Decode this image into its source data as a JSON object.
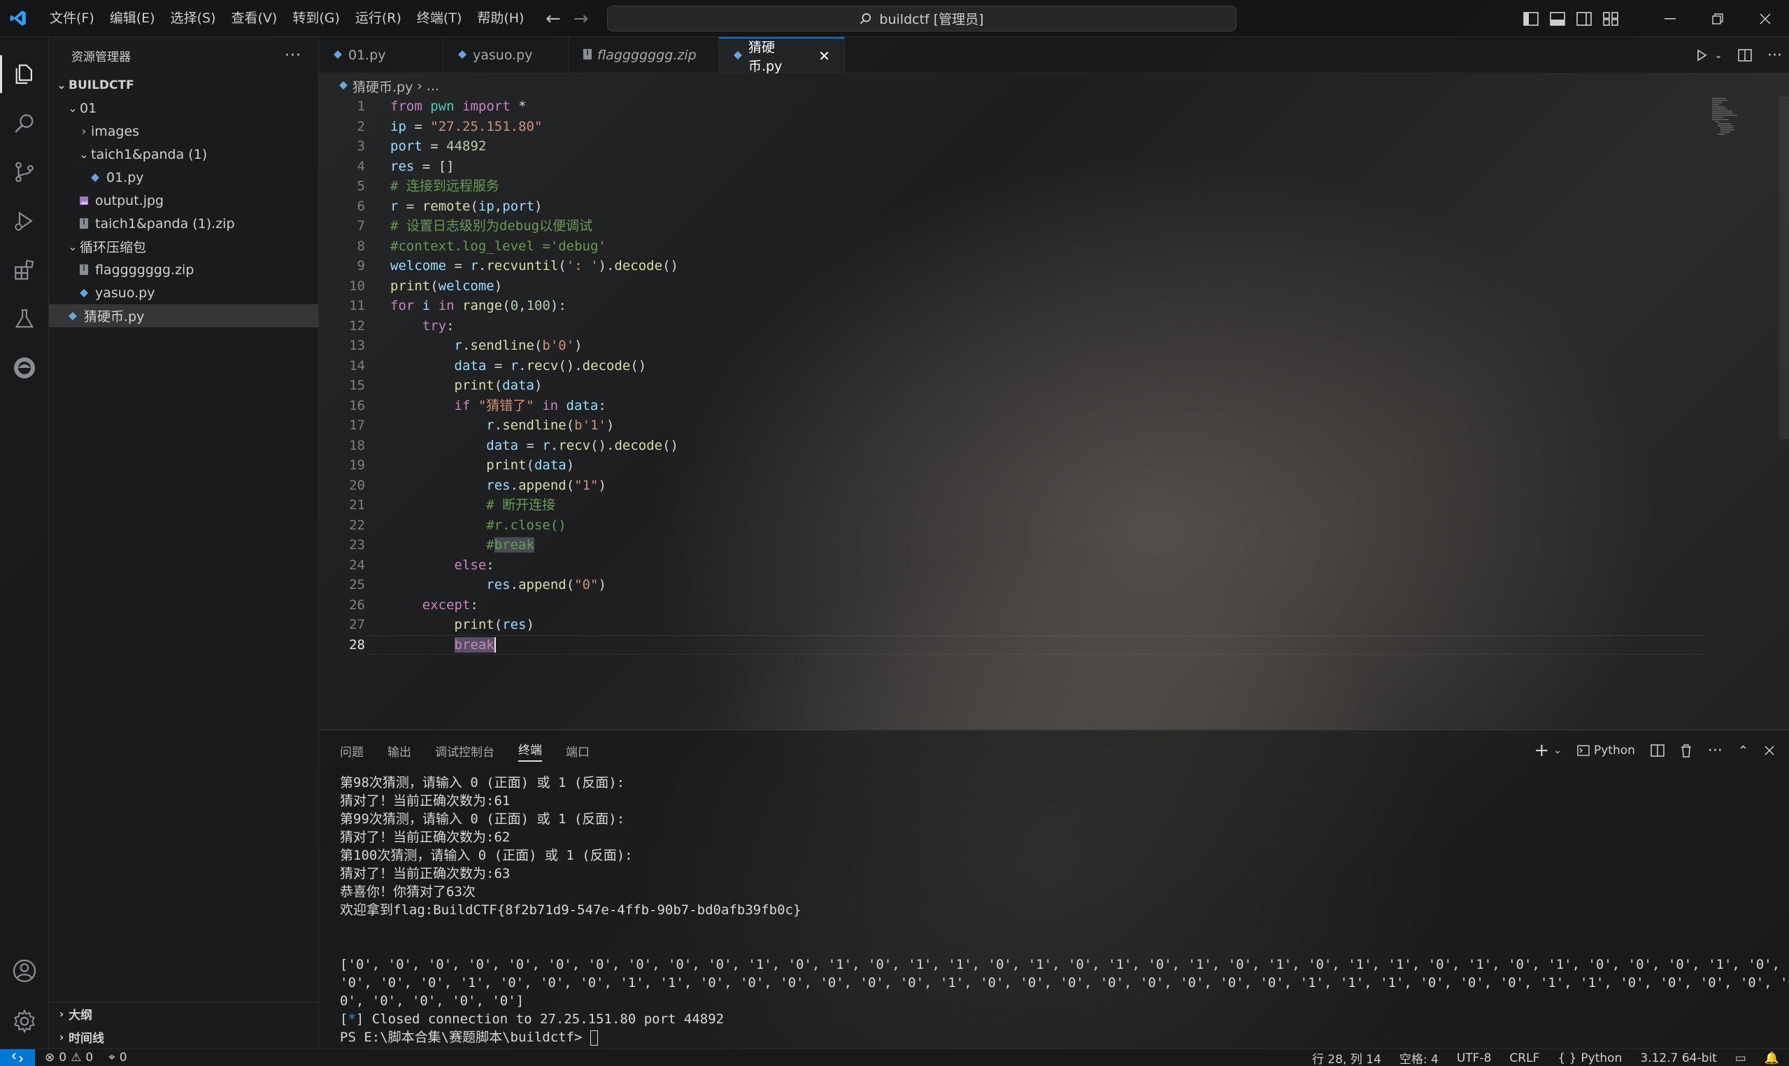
{
  "titlebar": {
    "menus": [
      "文件(F)",
      "编辑(E)",
      "选择(S)",
      "查看(V)",
      "转到(G)",
      "运行(R)",
      "终端(T)",
      "帮助(H)"
    ],
    "search_text": "buildctf [管理员]"
  },
  "sidebar": {
    "title": "资源管理器",
    "root": "BUILDCTF",
    "items": [
      {
        "label": "01",
        "type": "folder-open",
        "indent": 1
      },
      {
        "label": "images",
        "type": "folder-closed",
        "indent": 2
      },
      {
        "label": "taich1&panda (1)",
        "type": "folder-open",
        "indent": 2
      },
      {
        "label": "01.py",
        "type": "python",
        "indent": 3
      },
      {
        "label": "output.jpg",
        "type": "image",
        "indent": 2
      },
      {
        "label": "taich1&panda (1).zip",
        "type": "zip",
        "indent": 2
      },
      {
        "label": "循环压缩包",
        "type": "folder-open",
        "indent": 1
      },
      {
        "label": "flaggggggg.zip",
        "type": "zip",
        "indent": 2
      },
      {
        "label": "yasuo.py",
        "type": "python",
        "indent": 2
      },
      {
        "label": "猜硬币.py",
        "type": "python",
        "indent": 1,
        "selected": true
      }
    ],
    "outline": "大纲",
    "timeline": "时间线"
  },
  "tabs": [
    {
      "label": "01.py",
      "active": false,
      "italic": false
    },
    {
      "label": "yasuo.py",
      "active": false,
      "italic": false
    },
    {
      "label": "flaggggggg.zip",
      "active": false,
      "italic": true
    },
    {
      "label": "猜硬币.py",
      "active": true,
      "italic": false
    }
  ],
  "breadcrumb": {
    "file": "猜硬币.py",
    "rest": "..."
  },
  "code_lines": [
    "from pwn import *",
    "ip = \"27.25.151.80\"",
    "port = 44892",
    "res = []",
    "# 连接到远程服务",
    "r = remote(ip,port)",
    "# 设置日志级别为debug以便调试",
    "#context.log_level ='debug'",
    "welcome = r.recvuntil(': ').decode()",
    "print(welcome)",
    "for i in range(0,100):",
    "    try:",
    "        r.sendline(b'0')",
    "        data = r.recv().decode()",
    "        print(data)",
    "        if \"猜错了\" in data:",
    "            r.sendline(b'1')",
    "            data = r.recv().decode()",
    "            print(data)",
    "            res.append(\"1\")",
    "            # 断开连接",
    "            #r.close()",
    "            #break",
    "        else:",
    "            res.append(\"0\")",
    "    except:",
    "        print(res)",
    "        break"
  ],
  "active_line": 28,
  "panel": {
    "tabs": [
      "问题",
      "输出",
      "调试控制台",
      "终端",
      "端口"
    ],
    "active_tab": "终端",
    "terminal_type": "Python",
    "terminal_lines": [
      "第98次猜测，请输入 0 (正面) 或 1 (反面):",
      "猜对了！当前正确次数为:61",
      "第99次猜测，请输入 0 (正面) 或 1 (反面):",
      "猜对了！当前正确次数为:62",
      "第100次猜测，请输入 0 (正面) 或 1 (反面):",
      "猜对了！当前正确次数为:63",
      "恭喜你！你猜对了63次",
      "欢迎拿到flag:BuildCTF{8f2b71d9-547e-4ffb-90b7-bd0afb39fb0c}",
      "",
      "",
      "['0', '0', '0', '0', '0', '0', '0', '0', '0', '0', '1', '0', '1', '0', '1', '1', '0', '1', '0', '1', '0', '1', '0', '1', '0', '1', '1', '0', '1', '0', '1', '0', '0', '0', '1', '0', '1',",
      "'0', '0', '0', '1', '0', '0', '0', '1', '1', '0', '0', '0', '0', '0', '0', '1', '0', '0', '0', '0', '0', '0', '0', '0', '1', '1', '1', '0', '0', '0', '1', '1', '0', '0', '0', '0', '0',",
      "0', '0', '0', '0', '0']",
      "[*] Closed connection to 27.25.151.80 port 44892",
      "PS E:\\脚本合集\\赛题脚本\\buildctf> "
    ]
  },
  "statusbar": {
    "errors": "0",
    "warnings": "0",
    "ports": "0",
    "position": "行 28, 列 14",
    "spaces": "空格: 4",
    "encoding": "UTF-8",
    "eol": "CRLF",
    "language": "Python",
    "interpreter": "3.12.7 64-bit"
  }
}
